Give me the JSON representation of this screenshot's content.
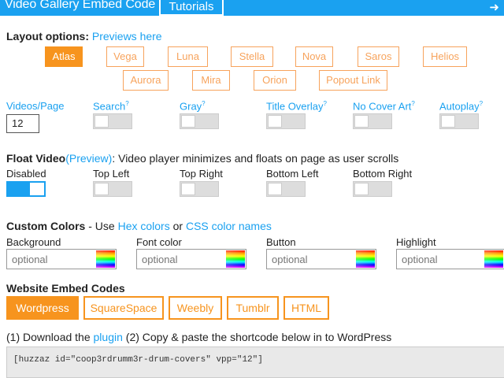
{
  "header": {
    "title": "Video Gallery Embed Code",
    "tutorials_label": "Tutorials",
    "exit_icon": "arrow-right-exit-icon"
  },
  "layout": {
    "heading": "Layout options:",
    "previews_link": "Previews here",
    "options": [
      "Atlas",
      "Vega",
      "Luna",
      "Stella",
      "Nova",
      "Saros",
      "Helios",
      "Aurora",
      "Mira",
      "Orion",
      "Popout Link"
    ],
    "selected": "Atlas"
  },
  "settings": {
    "videos_per_page_label": "Videos/Page",
    "videos_per_page_value": "12",
    "search_label": "Search",
    "gray_label": "Gray",
    "title_overlay_label": "Title Overlay",
    "no_cover_art_label": "No Cover Art",
    "autoplay_label": "Autoplay",
    "help_mark": "?"
  },
  "float_video": {
    "heading": "Float Video",
    "preview_link": "(Preview)",
    "description": ": Video player minimizes and floats on page as user scrolls",
    "options": [
      "Disabled",
      "Top Left",
      "Top Right",
      "Bottom Left",
      "Bottom Right"
    ],
    "selected": "Disabled"
  },
  "custom_colors": {
    "heading": "Custom Colors",
    "use_text": " - Use ",
    "hex_link": "Hex colors",
    "or_text": " or ",
    "css_link": "CSS color names",
    "fields": [
      {
        "label": "Background",
        "placeholder": "optional"
      },
      {
        "label": "Font color",
        "placeholder": "optional"
      },
      {
        "label": "Button",
        "placeholder": "optional"
      },
      {
        "label": "Highlight",
        "placeholder": "optional"
      }
    ]
  },
  "embed": {
    "heading": "Website Embed Codes",
    "tabs": [
      "Wordpress",
      "SquareSpace",
      "Weebly",
      "Tumblr",
      "HTML"
    ],
    "selected": "Wordpress",
    "instruction_1": "(1) Download the ",
    "plugin_link": "plugin",
    "instruction_2": " (2) Copy & paste the shortcode below in to WordPress",
    "shortcode": "[huzzaz id=\"coop3rdrumm3r-drum-covers\" vpp=\"12\"]"
  },
  "colors": {
    "accent_blue": "#1aa1f0",
    "accent_orange": "#f7941e"
  }
}
